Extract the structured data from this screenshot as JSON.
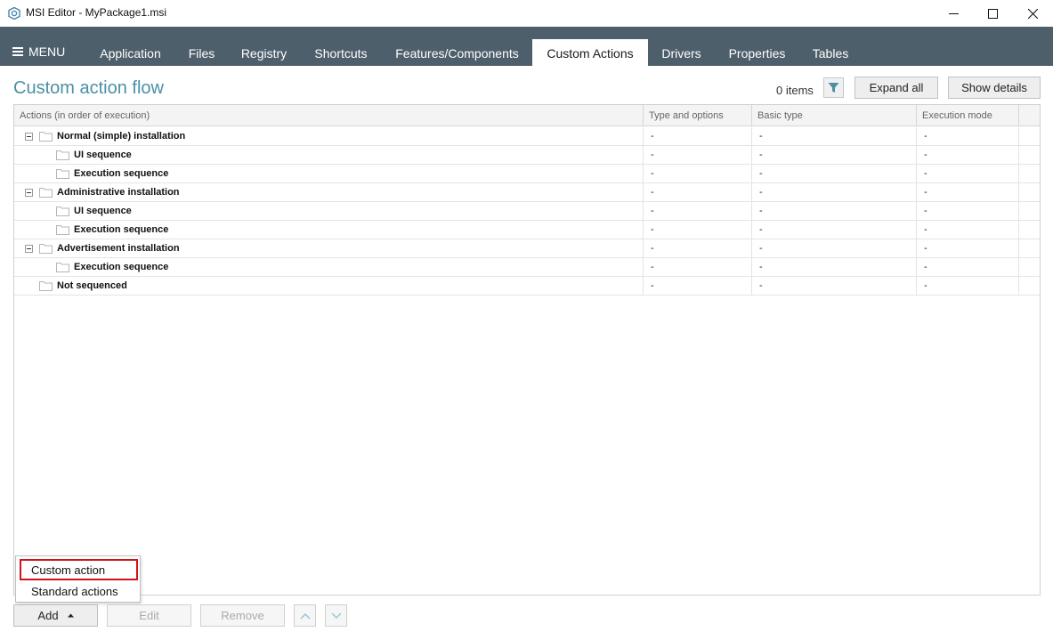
{
  "window": {
    "title": "MSI Editor - MyPackage1.msi"
  },
  "menu": {
    "label": "MENU"
  },
  "tabs": [
    {
      "label": "Application"
    },
    {
      "label": "Files"
    },
    {
      "label": "Registry"
    },
    {
      "label": "Shortcuts"
    },
    {
      "label": "Features/Components"
    },
    {
      "label": "Custom Actions",
      "active": true
    },
    {
      "label": "Drivers"
    },
    {
      "label": "Properties"
    },
    {
      "label": "Tables"
    }
  ],
  "page": {
    "title": "Custom action flow",
    "items_count": "0 items",
    "expand_all": "Expand all",
    "show_details": "Show details"
  },
  "grid": {
    "columns": [
      "Actions (in order of execution)",
      "Type and options",
      "Basic type",
      "Execution mode"
    ],
    "rows": [
      {
        "name": "Normal (simple) installation",
        "level": 0,
        "expandable": true,
        "type": "-",
        "basic": "-",
        "mode": "-"
      },
      {
        "name": "UI sequence",
        "level": 1,
        "expandable": false,
        "type": "-",
        "basic": "-",
        "mode": "-"
      },
      {
        "name": "Execution sequence",
        "level": 1,
        "expandable": false,
        "type": "-",
        "basic": "-",
        "mode": "-"
      },
      {
        "name": "Administrative installation",
        "level": 0,
        "expandable": true,
        "type": "-",
        "basic": "-",
        "mode": "-"
      },
      {
        "name": "UI sequence",
        "level": 1,
        "expandable": false,
        "type": "-",
        "basic": "-",
        "mode": "-"
      },
      {
        "name": "Execution sequence",
        "level": 1,
        "expandable": false,
        "type": "-",
        "basic": "-",
        "mode": "-"
      },
      {
        "name": "Advertisement installation",
        "level": 0,
        "expandable": true,
        "type": "-",
        "basic": "-",
        "mode": "-"
      },
      {
        "name": "Execution sequence",
        "level": 1,
        "expandable": false,
        "type": "-",
        "basic": "-",
        "mode": "-"
      },
      {
        "name": "Not sequenced",
        "level": 0,
        "expandable": false,
        "type": "-",
        "basic": "-",
        "mode": "-"
      }
    ]
  },
  "popup": {
    "items": [
      "Custom action",
      "Standard actions"
    ],
    "highlighted": "Custom action"
  },
  "bottom": {
    "add": "Add",
    "edit": "Edit",
    "remove": "Remove"
  },
  "colors": {
    "menubar": "#4d5f6b",
    "title_accent": "#4a90a4",
    "highlight_border": "#d0121b"
  },
  "icons": [
    "app-icon",
    "minimize-icon",
    "maximize-icon",
    "close-icon",
    "hamburger-icon",
    "filter-icon",
    "folder-icon",
    "collapse-icon",
    "caret-up-icon",
    "chevron-up-icon",
    "chevron-down-icon"
  ]
}
